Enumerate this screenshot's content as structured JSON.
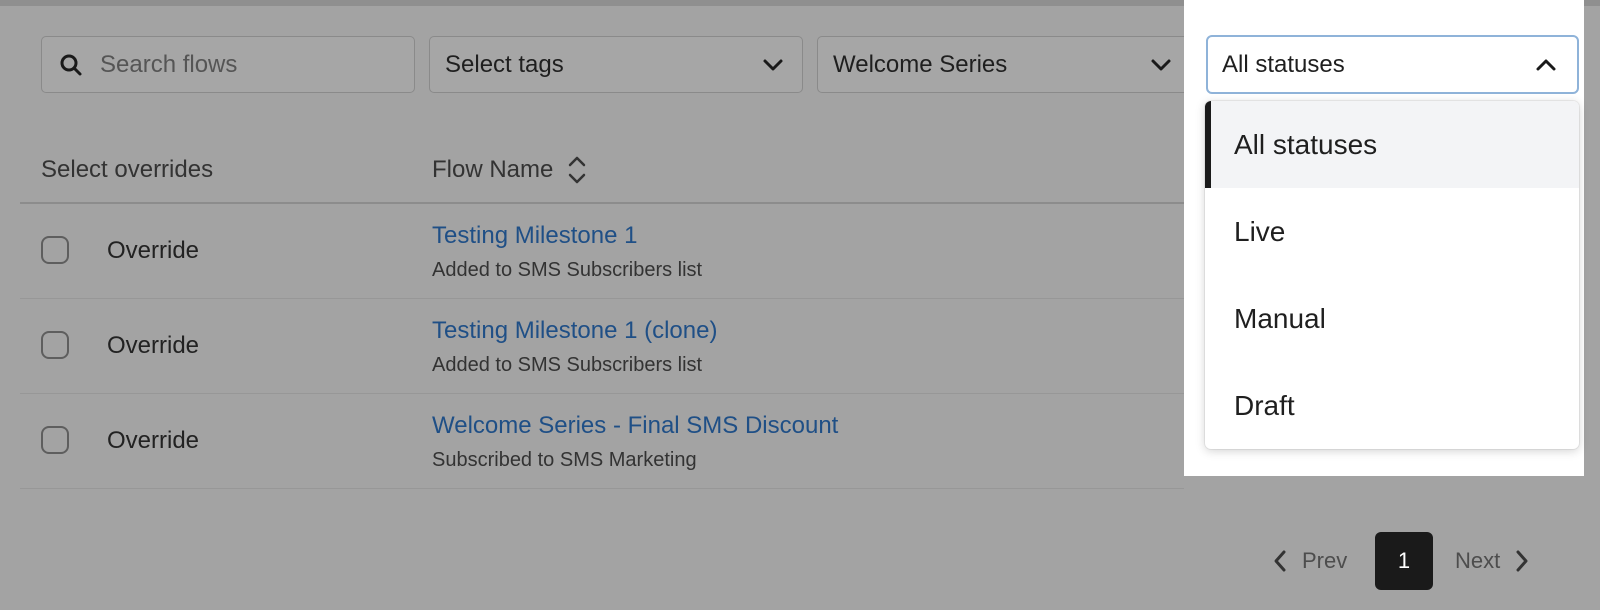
{
  "filters": {
    "search_placeholder": "Search flows",
    "tags_label": "Select tags",
    "series_label": "Welcome Series",
    "status_label": "All statuses"
  },
  "status_dropdown": {
    "options": [
      "All statuses",
      "Live",
      "Manual",
      "Draft"
    ],
    "selected": "All statuses"
  },
  "table": {
    "headers": {
      "select": "Select overrides",
      "flow_name": "Flow Name"
    },
    "rows": [
      {
        "override_label": "Override",
        "name": "Testing Milestone 1",
        "trigger": "Added to SMS Subscribers list",
        "checked": false
      },
      {
        "override_label": "Override",
        "name": "Testing Milestone 1 (clone)",
        "trigger": "Added to SMS Subscribers list",
        "checked": false
      },
      {
        "override_label": "Override",
        "name": "Welcome Series - Final SMS Discount",
        "trigger": "Subscribed to SMS Marketing",
        "checked": false
      }
    ]
  },
  "pagination": {
    "prev": "Prev",
    "current_page": "1",
    "next": "Next"
  },
  "colors": {
    "overlay": "#a3a3a3",
    "link": "#1f4f86",
    "active_page": "#1a1a1a",
    "focus_border": "#8fb3d9"
  }
}
